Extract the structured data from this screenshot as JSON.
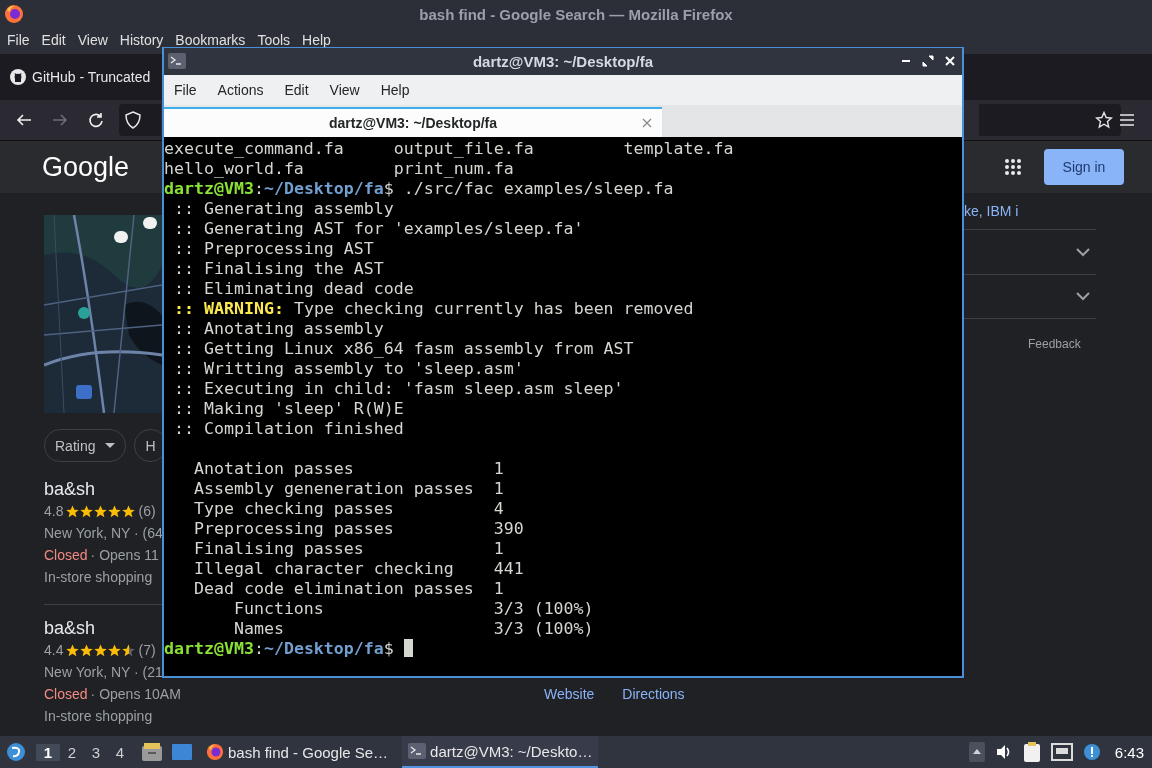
{
  "browser": {
    "title": "bash find - Google Search — Mozilla Firefox",
    "menu": [
      "File",
      "Edit",
      "View",
      "History",
      "Bookmarks",
      "Tools",
      "Help"
    ],
    "tab": {
      "label": "GitHub - Truncated"
    },
    "nav": [
      {
        "kind": "back",
        "disabled": false
      },
      {
        "kind": "forward",
        "disabled": true
      },
      {
        "kind": "reload",
        "disabled": false
      }
    ],
    "google": {
      "logo": "Google",
      "sign_in": "Sign in"
    },
    "chips": [
      {
        "label": "Rating",
        "dropdown": true
      },
      {
        "label": "H",
        "dropdown": false
      }
    ],
    "results": [
      {
        "name": "ba&sh",
        "rating": "4.8",
        "stars": 5,
        "count": "(6)",
        "address": "New York, NY · (64",
        "status": "Closed",
        "hours": " · Opens 11",
        "service": "In-store shopping"
      },
      {
        "name": "ba&sh",
        "rating": "4.4",
        "stars": 4.5,
        "count": "(7)",
        "address": "New York, NY · (21",
        "status": "Closed",
        "hours": " · Opens 10AM",
        "service": "In-store shopping"
      }
    ],
    "snippet": "ke, IBM i",
    "accordions": [
      {
        "expanded": false
      },
      {
        "expanded": false
      }
    ],
    "feedback": "Feedback",
    "actions": [
      "Website",
      "Directions"
    ]
  },
  "terminal": {
    "title": "dartz@VM3: ~/Desktop/fa",
    "menu": [
      "File",
      "Actions",
      "Edit",
      "View",
      "Help"
    ],
    "tab": {
      "label": "dartz@VM3: ~/Desktop/fa"
    },
    "lines": [
      {
        "kind": "text",
        "text": "execute_command.fa     output_file.fa         template.fa"
      },
      {
        "kind": "text",
        "text": "hello_world.fa         print_num.fa"
      },
      {
        "kind": "prompt",
        "user": "dartz@VM3",
        "sep": ":",
        "path": "~/Desktop/fa",
        "tail": "$ ./src/fac examples/sleep.fa"
      },
      {
        "kind": "text",
        "text": " :: Generating assembly"
      },
      {
        "kind": "text",
        "text": " :: Generating AST for 'examples/sleep.fa'"
      },
      {
        "kind": "text",
        "text": " :: Preprocessing AST"
      },
      {
        "kind": "text",
        "text": " :: Finalising the AST"
      },
      {
        "kind": "text",
        "text": " :: Eliminating dead code"
      },
      {
        "kind": "warning",
        "lead": " ::",
        "label": "WARNING:",
        "text": "Type checking currently has been removed"
      },
      {
        "kind": "text",
        "text": " :: Anotating assembly"
      },
      {
        "kind": "text",
        "text": " :: Getting Linux x86_64 fasm assembly from AST"
      },
      {
        "kind": "text",
        "text": " :: Writting assembly to 'sleep.asm'"
      },
      {
        "kind": "text",
        "text": " :: Executing in child: 'fasm sleep.asm sleep'"
      },
      {
        "kind": "text",
        "text": " :: Making 'sleep' R(W)E"
      },
      {
        "kind": "text",
        "text": " :: Compilation finished"
      },
      {
        "kind": "blank"
      },
      {
        "kind": "text",
        "text": "   Anotation passes              1"
      },
      {
        "kind": "text",
        "text": "   Assembly geneneration passes  1"
      },
      {
        "kind": "text",
        "text": "   Type checking passes          4"
      },
      {
        "kind": "text",
        "text": "   Preprocessing passes          390"
      },
      {
        "kind": "text",
        "text": "   Finalising passes             1"
      },
      {
        "kind": "text",
        "text": "   Illegal character checking    441"
      },
      {
        "kind": "text",
        "text": "   Dead code elimination passes  1"
      },
      {
        "kind": "text",
        "text": "       Functions                 3/3 (100%)"
      },
      {
        "kind": "text",
        "text": "       Names                     3/3 (100%)"
      },
      {
        "kind": "prompt",
        "user": "dartz@VM3",
        "sep": ":",
        "path": "~/Desktop/fa",
        "tail": "$",
        "cursor": true
      }
    ]
  },
  "taskbar": {
    "workspaces": [
      {
        "label": "1",
        "selected": true
      },
      {
        "label": "2",
        "selected": false
      },
      {
        "label": "3",
        "selected": false
      },
      {
        "label": "4",
        "selected": false
      }
    ],
    "tasks": [
      {
        "kind": "browser",
        "label": "bash find - Google Se…",
        "active": false
      },
      {
        "kind": "terminal",
        "label": "dartz@VM3: ~/Deskto…",
        "active": true
      }
    ],
    "clock": "6:43"
  }
}
